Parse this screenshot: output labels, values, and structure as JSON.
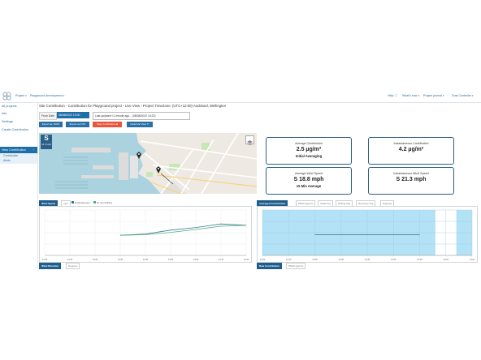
{
  "topbar": {
    "project_label": "Project",
    "project_name": "Playground development",
    "help_label": "Help",
    "whats_new_label": "What's new",
    "journal_label": "Project journal",
    "user_label": "Dust Controller"
  },
  "sidebar": {
    "items": [
      {
        "label": "All projects"
      },
      {
        "label": "Info"
      },
      {
        "label": "Settings"
      },
      {
        "label": "Create Contribution"
      },
      {
        "label": "View Contribution"
      }
    ],
    "sub_items": [
      {
        "label": "Contribution"
      },
      {
        "label": "Alerts"
      }
    ]
  },
  "main": {
    "title": "Site Contribution - Contribution for Playground project - Live View - Project TimeZone: (UTC+12:00) Auckland, Wellington",
    "from_label": "From Date",
    "from_value": "08/08/2022 13:00",
    "last_updated": "Last updated <1 minute ago... (08/08/2022 14:22)",
    "buttons": {
      "export_json": "Export as JSON",
      "export_csv": "Export as CSV",
      "stop": "Stop Contribution",
      "historical": "Historical View"
    }
  },
  "map": {
    "site_letter": "S",
    "site_sub": "21.3 mph"
  },
  "stats": {
    "avg_contribution": {
      "label": "Average Contribution",
      "value": "2.5 µg/m³",
      "sub": "Initial Averaging"
    },
    "inst_contribution": {
      "label": "Instantaneous Contribution",
      "value": "4.2 µg/m³"
    },
    "avg_wind": {
      "label": "Average Wind Speed",
      "value": "S 18.8 mph",
      "sub": "15 Min Average"
    },
    "inst_wind": {
      "label": "Instantaneous Wind Speed",
      "value": "S 21.3 mph"
    }
  },
  "wind_panel": {
    "tabs": [
      "Wind Speed",
      "mph"
    ],
    "legend": [
      "Instantaneous",
      "15 min Rolling"
    ],
    "bottom_tabs": [
      "Wind Direction",
      "Degrees"
    ]
  },
  "contrib_panel": {
    "tabs": [
      "Averaged Contribution",
      "PM10 (µg/m³)",
      "Initial Avg",
      "Rolling Avg",
      "Recovery Avg",
      "Stopped"
    ],
    "bottom_tabs": [
      "Raw Contribution",
      "PM10 (µg/m³)"
    ]
  },
  "colors": {
    "brand": "#1e6fa8",
    "card_border": "#2a5f87",
    "stop_button": "#e8543c",
    "wind_line": "#2e7d8c",
    "contrib_fill": "#b3e1f5"
  },
  "chart_data": [
    {
      "type": "line",
      "xlabel": "",
      "ylabel": "",
      "x": [
        "13:00",
        "13:10",
        "13:20",
        "13:30",
        "13:40",
        "13:50",
        "14:00",
        "14:10",
        "14:20"
      ],
      "series": [
        {
          "name": "Instantaneous",
          "values": [
            null,
            null,
            null,
            0.62,
            0.66,
            0.78,
            0.86,
            0.97,
            0.93
          ]
        },
        {
          "name": "15 min Rolling",
          "values": [
            null,
            null,
            null,
            0.62,
            0.64,
            0.71,
            0.8,
            0.9,
            0.93
          ]
        }
      ]
    },
    {
      "type": "line",
      "xlabel": "",
      "ylabel": "",
      "x": [
        "13:00",
        "13:10",
        "13:20",
        "13:30",
        "13:40",
        "13:50",
        "14:00",
        "14:10",
        "14:20"
      ],
      "series": [
        {
          "name": "PM10",
          "values": [
            null,
            null,
            1.0,
            1.0,
            1.0,
            1.0,
            1.0,
            null,
            1.1
          ]
        }
      ]
    }
  ]
}
